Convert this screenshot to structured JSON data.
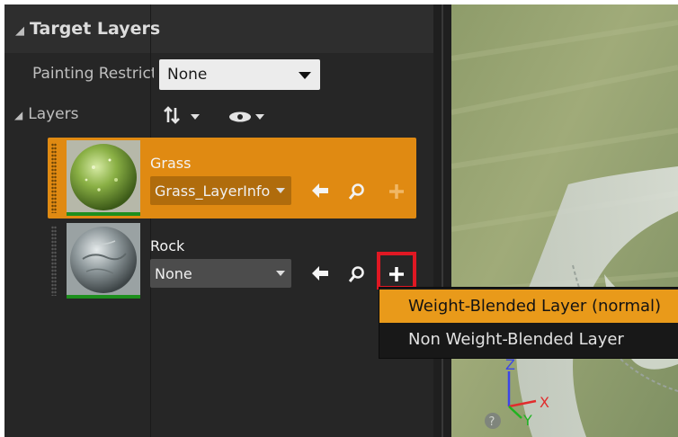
{
  "panel": {
    "header_title": "Target Layers",
    "painting_restriction_label": "Painting Restriction",
    "painting_restriction_value": "None",
    "layers_label": "Layers"
  },
  "layers": [
    {
      "name": "Grass",
      "info": "Grass_LayerInfo",
      "selected": true
    },
    {
      "name": "Rock",
      "info": "None",
      "selected": false
    }
  ],
  "context_menu": {
    "items": [
      "Weight-Blended Layer (normal)",
      "Non Weight-Blended Layer"
    ]
  },
  "colors": {
    "selected_layer": "#e08a12",
    "menu_highlight": "#e99a1a",
    "plus_highlight_border": "#e01823",
    "thumb_bar": "#1d8f1d"
  },
  "gizmo": {
    "z": "Z",
    "x": "X",
    "y": "Y"
  },
  "icons": [
    "sort-icon",
    "visibility-eye-icon",
    "use-selected-asset-arrow-icon",
    "browse-magnifier-icon",
    "create-layer-info-plus-icon",
    "question-help-icon"
  ]
}
